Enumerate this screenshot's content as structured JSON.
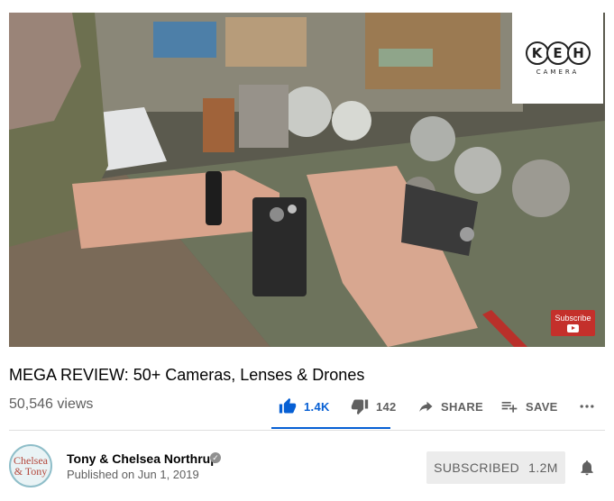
{
  "player": {
    "brand_letters": [
      "K",
      "E",
      "H"
    ],
    "brand_sub": "CAMERA",
    "subscribe_watermark": "Subscribe"
  },
  "video": {
    "title": "MEGA REVIEW: 50+ Cameras, Lenses & Drones",
    "views": "50,546 views",
    "likes": "1.4K",
    "dislikes": "142",
    "like_ratio": 1.0
  },
  "actions": {
    "share_label": "SHARE",
    "save_label": "SAVE"
  },
  "channel": {
    "avatar_line1": "Chelsea",
    "avatar_line2": "& Tony",
    "name": "Tony & Chelsea Northrup",
    "published": "Published on Jun 1, 2019",
    "subscribed_label": "SUBSCRIBED",
    "subscriber_count": "1.2M"
  },
  "colors": {
    "accent": "#065fd4",
    "subscribe_red": "#c4302b",
    "secondary_text": "#606060"
  },
  "icons": [
    "thumb-up-icon",
    "thumb-down-icon",
    "share-arrow-icon",
    "playlist-add-icon",
    "more-horizontal-icon",
    "verified-check-icon",
    "bell-icon"
  ]
}
